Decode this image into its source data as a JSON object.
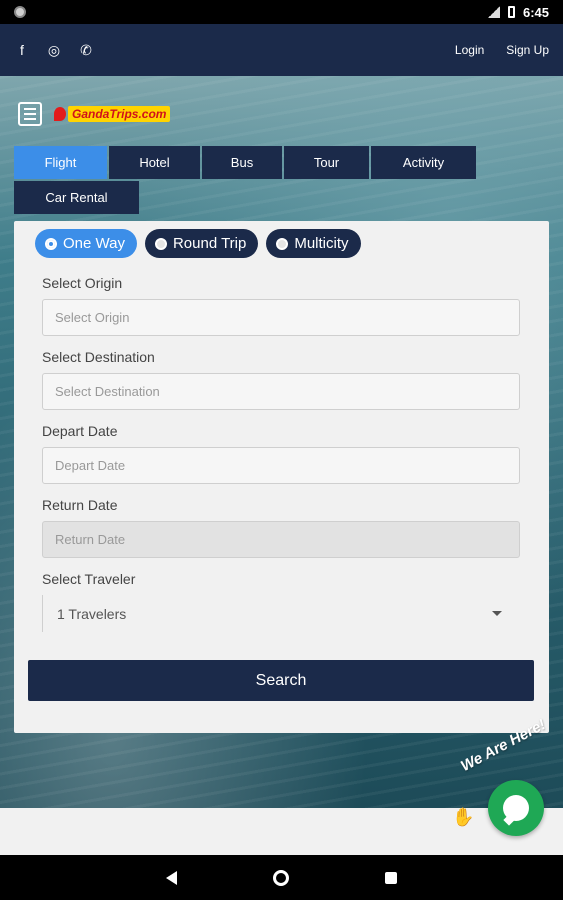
{
  "status_bar": {
    "time": "6:45"
  },
  "top_nav": {
    "social": [
      {
        "icon": "facebook-icon",
        "glyph": "f"
      },
      {
        "icon": "instagram-icon",
        "glyph": "◎"
      },
      {
        "icon": "phone-icon",
        "glyph": "✆"
      }
    ],
    "login_label": "Login",
    "signup_label": "Sign Up"
  },
  "brand": {
    "logo_text": "GandaTrips.com"
  },
  "tabs": [
    {
      "label": "Flight",
      "active": true
    },
    {
      "label": "Hotel",
      "active": false
    },
    {
      "label": "Bus",
      "active": false
    },
    {
      "label": "Tour",
      "active": false
    },
    {
      "label": "Activity",
      "active": false
    },
    {
      "label": "Car Rental",
      "active": false
    }
  ],
  "trip_types": [
    {
      "label": "One Way",
      "selected": true
    },
    {
      "label": "Round Trip",
      "selected": false
    },
    {
      "label": "Multicity",
      "selected": false
    }
  ],
  "form": {
    "origin": {
      "label": "Select Origin",
      "placeholder": "Select Origin"
    },
    "destination": {
      "label": "Select Destination",
      "placeholder": "Select Destination"
    },
    "depart": {
      "label": "Depart Date",
      "placeholder": "Depart Date"
    },
    "return": {
      "label": "Return Date",
      "placeholder": "Return Date"
    },
    "traveler": {
      "label": "Select Traveler",
      "value": "1 Travelers"
    },
    "search_label": "Search"
  },
  "chat": {
    "text": "We Are Here!"
  },
  "colors": {
    "navy": "#1b2a4a",
    "accent": "#3c8ee8",
    "chat_green": "#1fa855"
  }
}
